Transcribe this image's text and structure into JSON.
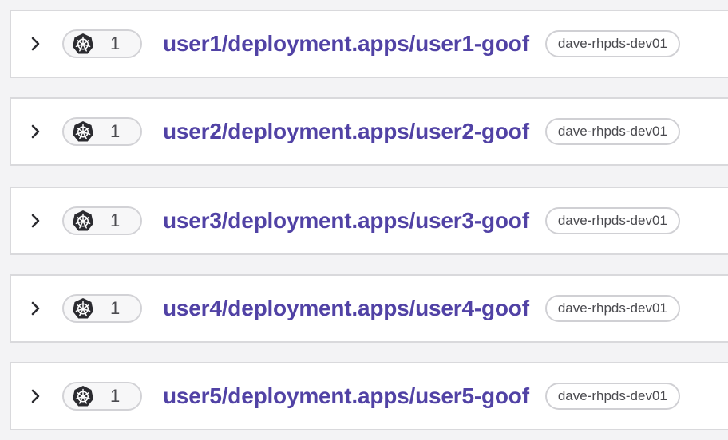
{
  "rows": [
    {
      "count": "1",
      "title": "user1/deployment.apps/user1-goof",
      "cluster": "dave-rhpds-dev01"
    },
    {
      "count": "1",
      "title": "user2/deployment.apps/user2-goof",
      "cluster": "dave-rhpds-dev01"
    },
    {
      "count": "1",
      "title": "user3/deployment.apps/user3-goof",
      "cluster": "dave-rhpds-dev01"
    },
    {
      "count": "1",
      "title": "user4/deployment.apps/user4-goof",
      "cluster": "dave-rhpds-dev01"
    },
    {
      "count": "1",
      "title": "user5/deployment.apps/user5-goof",
      "cluster": "dave-rhpds-dev01"
    }
  ],
  "icons": {
    "expand": "chevron-right-icon",
    "resource": "kubernetes-icon"
  },
  "colors": {
    "title": "#5142a5",
    "icon": "#2b2b30",
    "background": "#f3f3f5"
  }
}
